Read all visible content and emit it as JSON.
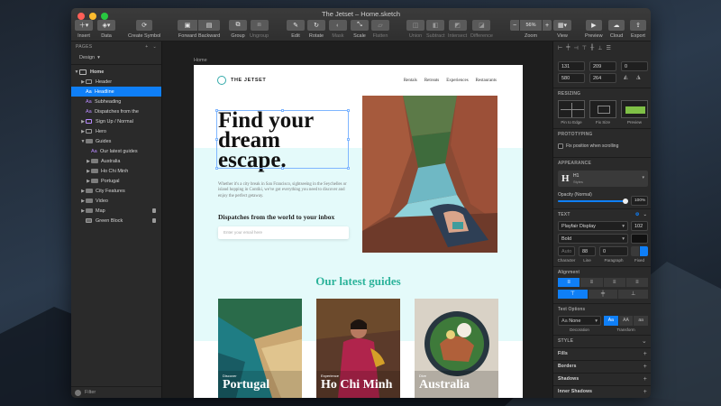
{
  "window": {
    "title": "The Jetset – Home.sketch",
    "light_colors": [
      "#fe5f57",
      "#febc2e",
      "#28c840"
    ]
  },
  "toolbar": {
    "insert": "Insert",
    "data": "Data",
    "create_symbol": "Create Symbol",
    "forward": "Forward",
    "backward": "Backward",
    "group": "Group",
    "ungroup": "Ungroup",
    "edit": "Edit",
    "rotate": "Rotate",
    "mask": "Mask",
    "scale": "Scale",
    "flatten": "Flatten",
    "union": "Union",
    "subtract": "Subtract",
    "intersect": "Intersect",
    "difference": "Difference",
    "zoom": "Zoom",
    "zoom_value": "56%",
    "view": "View",
    "preview": "Preview",
    "cloud": "Cloud",
    "export": "Export"
  },
  "sidebar": {
    "pages_header": "PAGES",
    "page_select": "Design",
    "filter": "Filter",
    "layers": [
      {
        "label": "Home"
      },
      {
        "label": "Header"
      },
      {
        "label": "Headline"
      },
      {
        "label": "Subheading"
      },
      {
        "label": "Dispatches from the"
      },
      {
        "label": "Sign Up / Normal"
      },
      {
        "label": "Hero"
      },
      {
        "label": "Guides"
      },
      {
        "label": "Our latest guides"
      },
      {
        "label": "Australia"
      },
      {
        "label": "Ho Chi Minh"
      },
      {
        "label": "Portugal"
      },
      {
        "label": "City Features"
      },
      {
        "label": "Video"
      },
      {
        "label": "Map"
      },
      {
        "label": "Green Block"
      }
    ]
  },
  "canvas": {
    "artboard_label": "Home",
    "site": {
      "logo": "THE JETSET",
      "nav": [
        "Rentals",
        "Retreats",
        "Experiences",
        "Restaurants"
      ],
      "headline_lines": [
        "Find your",
        "dream",
        "escape."
      ],
      "body": "Whether it's a city break in San Francisco, sightseeing in the Seychelles or island hopping in Contiki, we've got everything you need to discover and enjoy the perfect getaway.",
      "dispatch": "Dispatches from the world to your inbox",
      "email_placeholder": "Enter your email here",
      "guides_title": "Our latest guides",
      "cards": [
        {
          "sub": "Discover",
          "title": "Portugal"
        },
        {
          "sub": "Experience",
          "title": "Ho Chi Minh"
        },
        {
          "sub": "Dive",
          "title": "Australia"
        }
      ]
    }
  },
  "inspector": {
    "x": "131",
    "y": "209",
    "rot": "0",
    "w": "580",
    "h": "264",
    "resizing": "RESIZING",
    "pin_to_edge": "Pin to Edge",
    "fix_size": "Fix Size",
    "preview_label": "Preview",
    "prototyping": "PROTOTYPING",
    "fix_scroll": "Fix position when scrolling",
    "appearance": "APPEARANCE",
    "style_name": "H1",
    "style_sub": "Styles",
    "opacity_label": "Opacity (Normal)",
    "opacity_value": "100%",
    "opacity_fraction": 1.0,
    "text": "TEXT",
    "font": "Playfair Display",
    "font_size": "102",
    "weight": "Bold",
    "char_value": "Auto",
    "line_value": "88",
    "para_value": "0",
    "char_label": "Character",
    "line_label": "Line",
    "para_label": "Paragraph",
    "fixed_label": "Fixed",
    "alignment": "Alignment",
    "text_options": "Text Options",
    "decoration": "None",
    "decoration_label": "Decoration",
    "transform_label": "Transform",
    "transform_opts": [
      "Aa",
      "AA",
      "aa"
    ],
    "style": "STYLE",
    "fills": "Fills",
    "borders": "Borders",
    "shadows": "Shadows",
    "inner_shadows": "Inner Shadows"
  },
  "colors": {
    "accent": "#0f7ff7",
    "brand_green": "#2bb39a",
    "mint": "#e4fafa"
  }
}
